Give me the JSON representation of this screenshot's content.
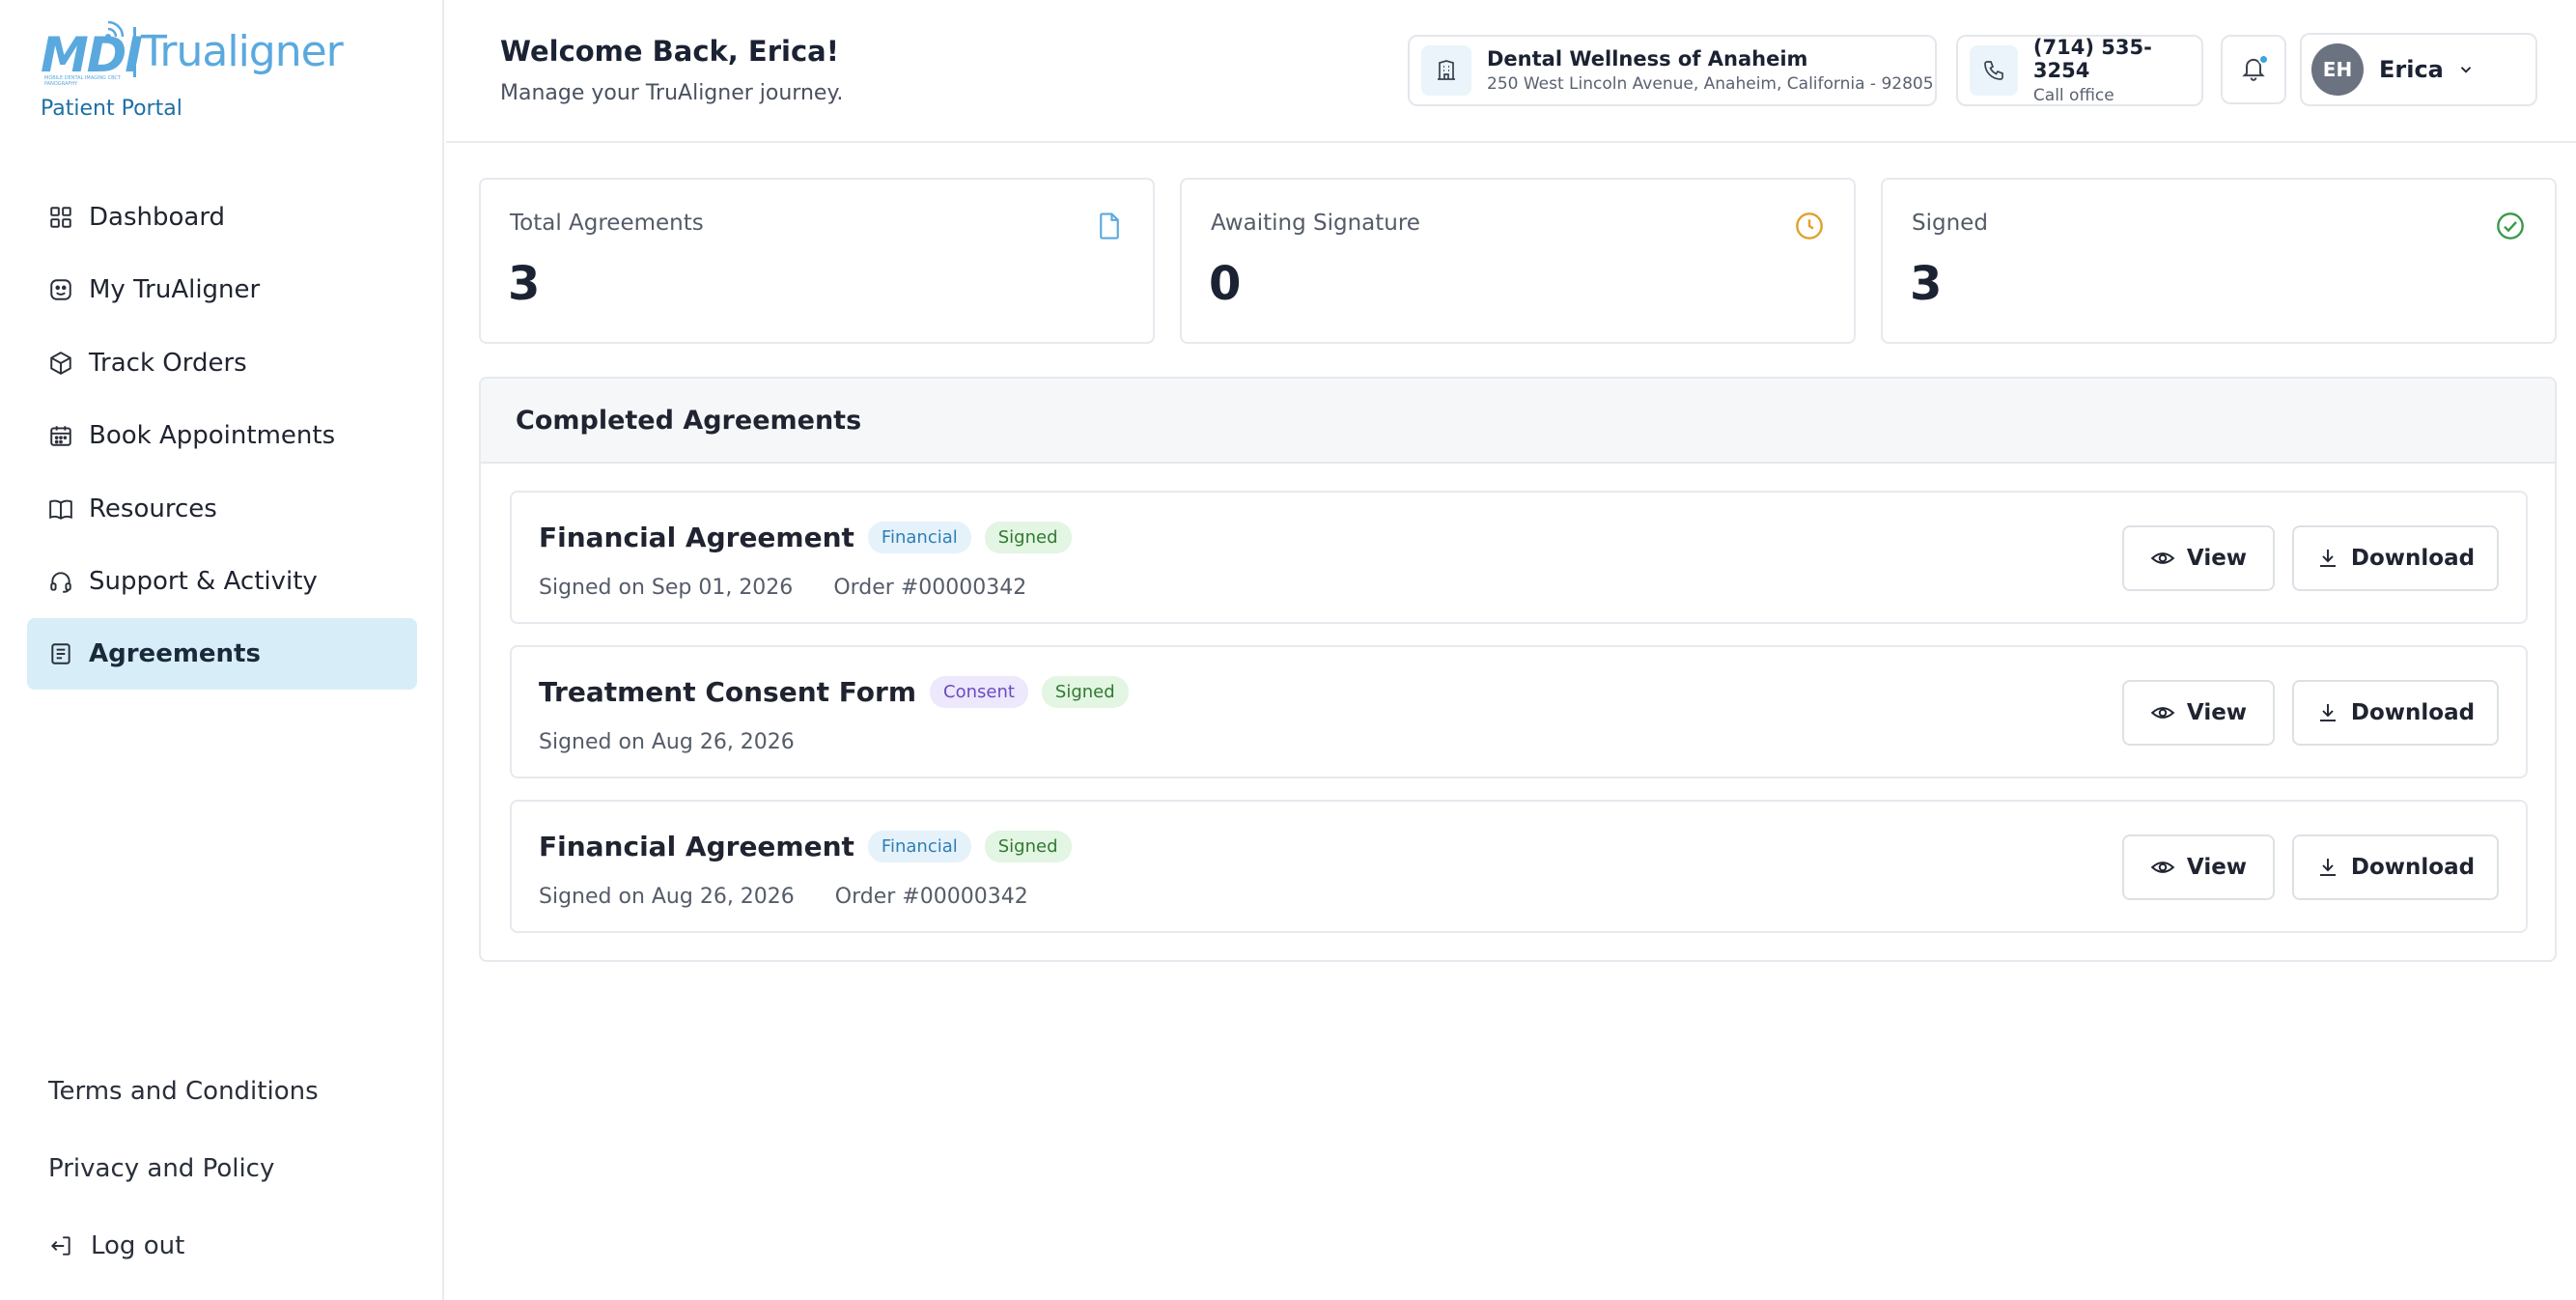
{
  "brand": {
    "logo_mark": "MDI",
    "logo_tagline": "MOBILE DENTAL IMAGING CBCT PANOGRAPHY",
    "logo_text": "Trualigner",
    "portal_label": "Patient Portal",
    "accent_color": "#5aa9de"
  },
  "sidebar": {
    "items": [
      {
        "label": "Dashboard",
        "icon": "dashboard-grid-icon"
      },
      {
        "label": "My TruAligner",
        "icon": "aligner-icon"
      },
      {
        "label": "Track Orders",
        "icon": "package-icon"
      },
      {
        "label": "Book Appointments",
        "icon": "calendar-icon"
      },
      {
        "label": "Resources",
        "icon": "book-icon"
      },
      {
        "label": "Support & Activity",
        "icon": "headset-icon"
      },
      {
        "label": "Agreements",
        "icon": "document-icon",
        "active": true
      }
    ],
    "footer": {
      "terms": "Terms and Conditions",
      "privacy": "Privacy and Policy",
      "logout": "Log out"
    }
  },
  "header": {
    "title": "Welcome Back, Erica!",
    "subtitle": "Manage your TruAligner journey.",
    "clinic": {
      "name": "Dental Wellness of Anaheim",
      "address": "250 West Lincoln Avenue, Anaheim, California - 92805"
    },
    "phone": {
      "number": "(714) 535-3254",
      "label": "Call office"
    },
    "user": {
      "initials": "EH",
      "name": "Erica"
    }
  },
  "stats": [
    {
      "label": "Total Agreements",
      "value": "3",
      "icon": "file-icon",
      "color": "#5aa9de"
    },
    {
      "label": "Awaiting Signature",
      "value": "0",
      "icon": "clock-icon",
      "color": "#e0a030"
    },
    {
      "label": "Signed",
      "value": "3",
      "icon": "check-circle-icon",
      "color": "#3a9a4a"
    }
  ],
  "agreements": {
    "title": "Completed Agreements",
    "view_label": "View",
    "download_label": "Download",
    "items": [
      {
        "title": "Financial Agreement",
        "type": "Financial",
        "status": "Signed",
        "signed": "Signed on Sep 01, 2026",
        "order": "Order #00000342"
      },
      {
        "title": "Treatment Consent Form",
        "type": "Consent",
        "status": "Signed",
        "signed": "Signed on Aug 26, 2026",
        "order": ""
      },
      {
        "title": "Financial Agreement",
        "type": "Financial",
        "status": "Signed",
        "signed": "Signed on Aug 26, 2026",
        "order": "Order #00000342"
      }
    ]
  }
}
